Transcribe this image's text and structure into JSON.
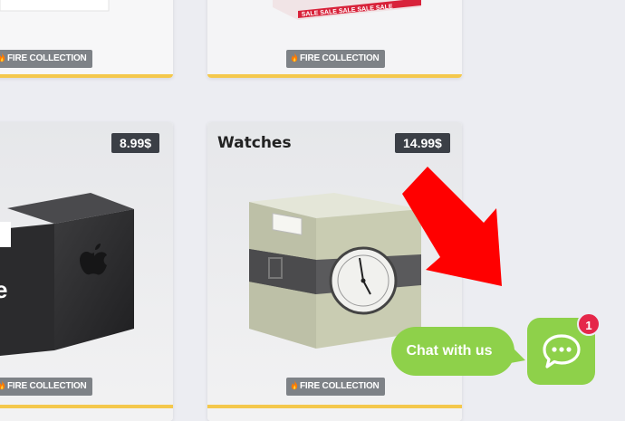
{
  "products": [
    {
      "badge": "FIRE COLLECTION",
      "image": "product-box-top-left"
    },
    {
      "badge": "FIRE COLLECTION",
      "image": "sale-box",
      "sale_text": "SALE SALE SALE SALE SALE"
    },
    {
      "badge": "FIRE COLLECTION",
      "image": "apple-box",
      "price": "8.99$"
    },
    {
      "badge": "FIRE COLLECTION",
      "image": "watch-box",
      "price": "14.99$",
      "title": "Watches"
    }
  ],
  "chat": {
    "label": "Chat with us",
    "unread_count": "1",
    "icon": "chat-bubble-icon",
    "color": "#8ed14a"
  },
  "accent_bar_color": "#f4c84c",
  "annotation_arrow_color": "#ff0000"
}
